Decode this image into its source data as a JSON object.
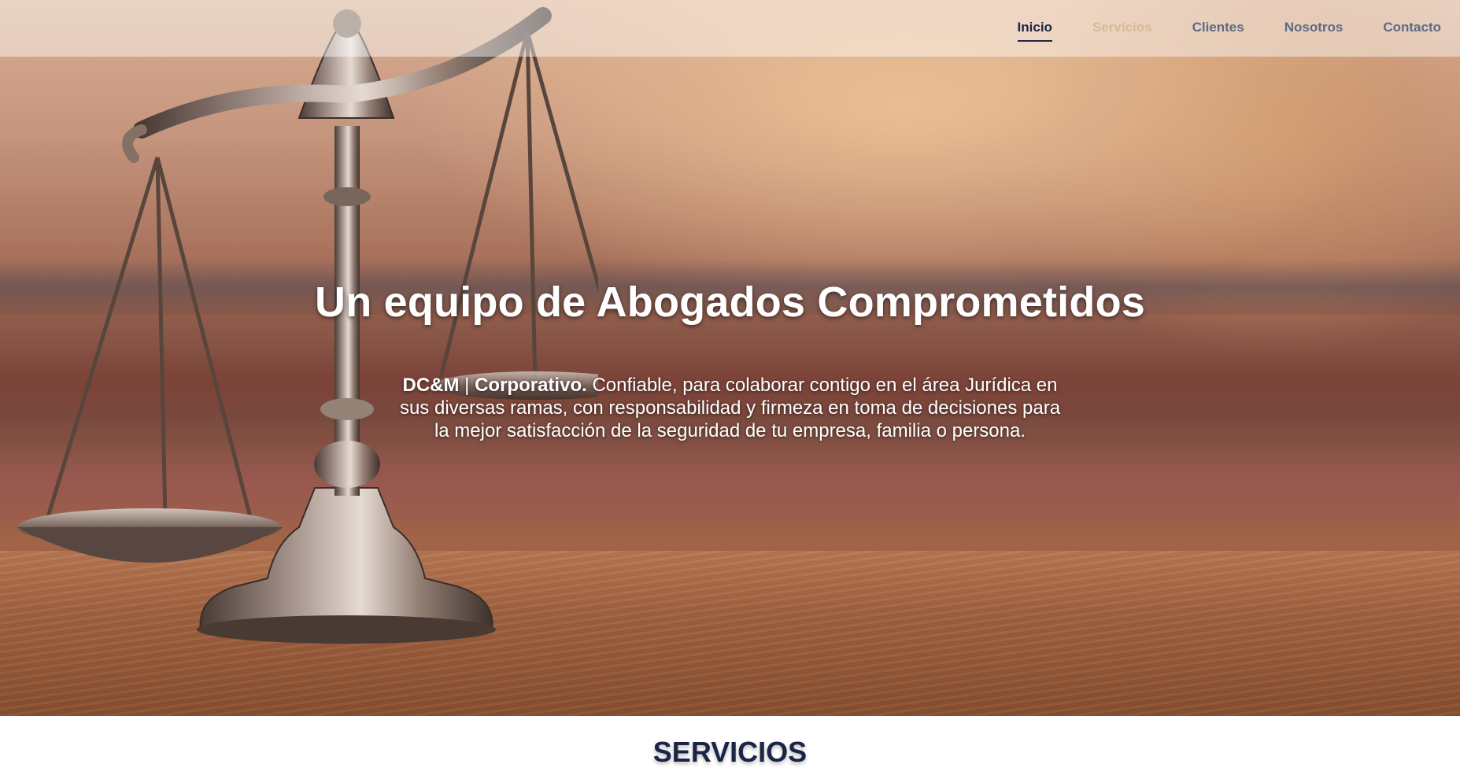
{
  "nav": {
    "items": [
      {
        "label": "Inicio",
        "state": "active"
      },
      {
        "label": "Servicios",
        "state": "muted"
      },
      {
        "label": "Clientes",
        "state": "normal"
      },
      {
        "label": "Nosotros",
        "state": "normal"
      },
      {
        "label": "Contacto",
        "state": "normal"
      }
    ]
  },
  "hero": {
    "title": "Un equipo de Abogados Comprometidos",
    "brand": "DC&M",
    "separator": " | ",
    "brand_suffix": "Corporativo.",
    "description": " Confiable, para colaborar contigo en el área Jurídica en sus diversas ramas, con responsabilidad y firmeza en toma de decisiones para la mejor satisfacción de la seguridad de tu empresa, familia o persona.",
    "image_icon": "scales-of-justice-icon"
  },
  "services": {
    "title": "SERVICIOS"
  },
  "colors": {
    "navy": "#1b2545",
    "nav_text": "#5b6b86",
    "white": "#ffffff"
  }
}
